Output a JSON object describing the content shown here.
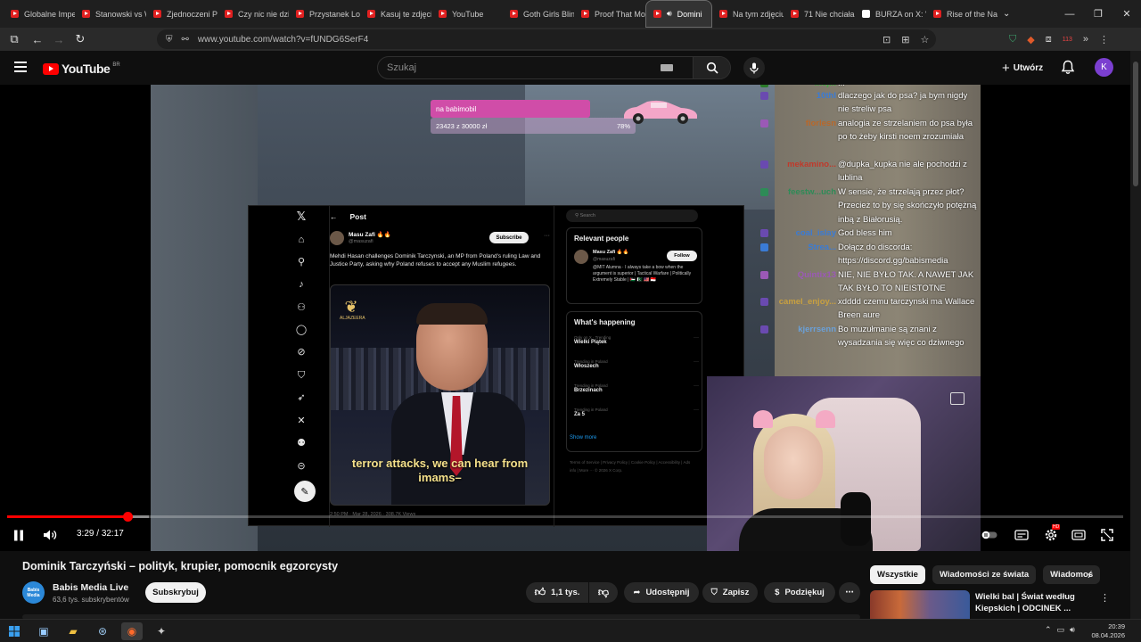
{
  "browser": {
    "tabs": [
      {
        "label": "Globalne Impe",
        "kind": "yt"
      },
      {
        "label": "Stanowski vs W",
        "kind": "yt"
      },
      {
        "label": "Zjednoczeni P",
        "kind": "yt"
      },
      {
        "label": "Czy nic nie dzi",
        "kind": "yt"
      },
      {
        "label": "Przystanek Lon",
        "kind": "yt"
      },
      {
        "label": "Kasuj te zdjęci",
        "kind": "yt"
      },
      {
        "label": "YouTube",
        "kind": "yt"
      },
      {
        "label": "Goth Girls Blin",
        "kind": "yt"
      },
      {
        "label": "Proof That Mo",
        "kind": "yt"
      },
      {
        "label": "Domini",
        "kind": "yt",
        "active": true
      },
      {
        "label": "Na tym zdjęciu",
        "kind": "yt"
      },
      {
        "label": "71 Nie chciała",
        "kind": "yt"
      },
      {
        "label": "BURZA on X: \"",
        "kind": "x"
      },
      {
        "label": "Rise of the Na",
        "kind": "yt"
      }
    ],
    "url": "www.youtube.com/watch?v=fUNDG6SerF4",
    "ext_badge": "113"
  },
  "header": {
    "logo_text": "YouTube",
    "country": "BR",
    "search_placeholder": "Szukaj",
    "create_label": "Utwórz",
    "avatar_letter": "K"
  },
  "overlay": {
    "goal_title": "na babimobil",
    "goal_progress": "23423 z 30000 zł",
    "goal_percent": "78%",
    "goal_fraction": 0.78
  },
  "xpost": {
    "header": "Post",
    "author_name": "Masu Zafi 🔥🔥",
    "author_handle": "@masuzafi",
    "subscribe": "Subscribe",
    "text": "Mehdi Hasan challenges Dominik Tarczynski, an MP from Poland's ruling Law and Justice Party, asking why Poland refuses to accept any Muslim refugees.",
    "media_logo": "ALJAZEERA",
    "subtitle": "terror attacks, we can hear from imams–",
    "meta": "2:50 PM · Mar 28, 2026 · 308.7K Views",
    "search_placeholder": "Search",
    "relevant_title": "Relevant people",
    "rel_name": "Masu Zafi 🔥🔥",
    "rel_handle": "@masuzafi",
    "follow": "Follow",
    "rel_bio": "@MIT Alumna · I always take a bow when the argument is superior | Tactical Warfare | Politically Extremely Stable | 🇵🇸 🇵🇰 🇲🇾 🇮🇩",
    "happening_title": "What's happening",
    "trends": [
      {
        "ctx": "Only on X · Trending",
        "name": "Wielki Piątek"
      },
      {
        "ctx": "Trending in Poland",
        "name": "Włoszech"
      },
      {
        "ctx": "Trending in Poland",
        "name": "Brzezinach"
      },
      {
        "ctx": "Trending in Poland",
        "name": "Za 5"
      }
    ],
    "show_more": "Show more",
    "footer": "Terms of Service | Privacy Policy | Cookie Policy | Accessibility | Ads info | More ··· © 2026 X Corp."
  },
  "chat": [
    {
      "user": "mej...",
      "color": "#44aa44",
      "msg": "..."
    },
    {
      "user": "10thl",
      "color": "#3a7bd5",
      "msg": "dlaczego jak do psa? ja bym nigdy nie streliw psa"
    },
    {
      "user": "fiorlesn",
      "color": "#b8682a",
      "msg": "analogia ze strzelaniem do psa była po to żeby kirsti noem zrozumiała"
    },
    {
      "user": "mekamino...",
      "color": "#c0392b",
      "msg": "@dupka_kupka nie ale pochodzi z lublina"
    },
    {
      "user": "feestw...uch",
      "color": "#2e8b57",
      "msg": "W sensie, że strzelają przez płot? Przecież to by się skończyło potężną inbą z Białorusią."
    },
    {
      "user": "coal_islay",
      "color": "#3a7bd5",
      "msg": "God bless him"
    },
    {
      "user": "Strea...",
      "color": "#3a7bd5",
      "msg": "Dołącz do discorda: https://discord.gg/babismedia"
    },
    {
      "user": "Quintix13",
      "color": "#9b59b6",
      "msg": "NIE, NIE BYŁO TAK. A NAWET JAK TAK BYŁO TO NIEISTOTNE"
    },
    {
      "user": "camel_enjoy...",
      "color": "#c8a040",
      "msg": "xdddd czemu tarczynski ma Wallace Breen aure"
    },
    {
      "user": "kjerrsenn",
      "color": "#6aa0d8",
      "msg": "Bo muzułmanie są znani z wysadzania się więc co dziwnego"
    }
  ],
  "player": {
    "current_time": "3:29",
    "duration": "32:17",
    "played_fraction": 0.108
  },
  "video": {
    "title": "Dominik Tarczyński – polityk, krupier, pomocnik egzorcysty",
    "channel": "Babis Media Live",
    "channel_avatar_text": "Babis Media",
    "subscribers": "63,6 tys. subskrybentów",
    "subscribe_label": "Subskrybuj",
    "likes": "1,1 tys.",
    "share_label": "Udostępnij",
    "save_label": "Zapisz",
    "thanks_label": "Podziękuj"
  },
  "related": {
    "chips": [
      {
        "label": "Wszystkie",
        "selected": true
      },
      {
        "label": "Wiadomości ze świata",
        "selected": false
      },
      {
        "label": "Wiadomoś",
        "selected": false
      }
    ],
    "first_video_title": "Wielki bal | Świat według Kiepskich | ODCINEK ..."
  },
  "taskbar": {
    "time": "20:39",
    "date": "08.04.2026"
  }
}
